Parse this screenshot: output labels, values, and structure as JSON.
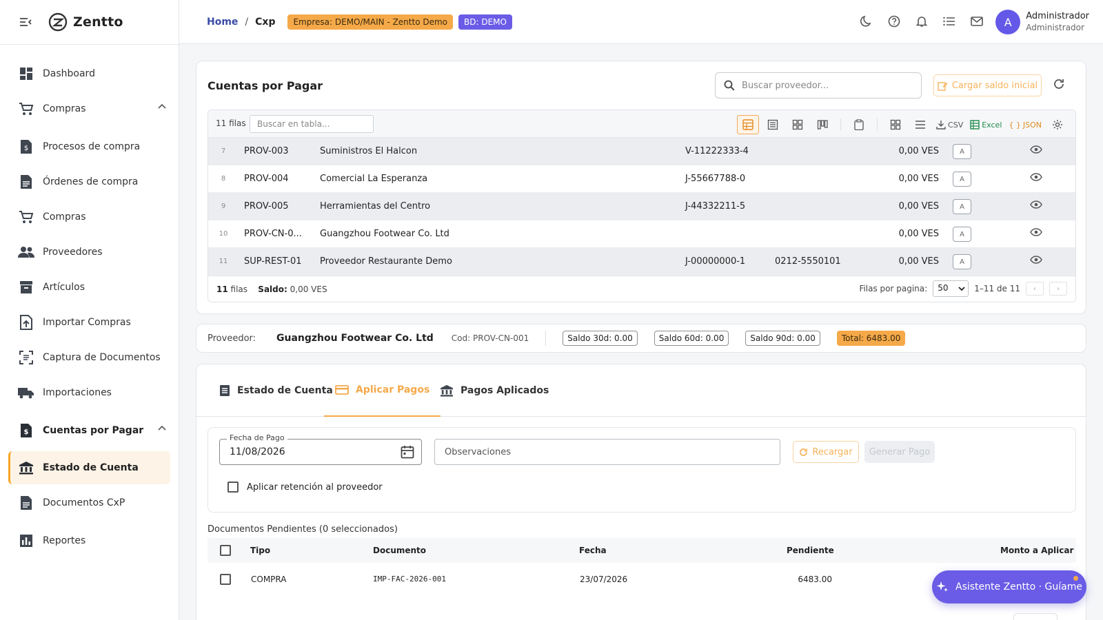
{
  "app": {
    "logo_text": "Zentto"
  },
  "sidebar": {
    "items": [
      {
        "label": "Dashboard",
        "icon": "dashboard-icon"
      },
      {
        "label": "Compras",
        "icon": "cart-icon",
        "expanded": true
      },
      {
        "label": "Procesos de compra",
        "icon": "dollar-doc-icon"
      },
      {
        "label": "Órdenes de compra",
        "icon": "document-icon"
      },
      {
        "label": "Compras",
        "icon": "cart-icon"
      },
      {
        "label": "Proveedores",
        "icon": "people-icon"
      },
      {
        "label": "Artículos",
        "icon": "archive-icon"
      },
      {
        "label": "Importar Compras",
        "icon": "upload-doc-icon"
      },
      {
        "label": "Captura de Documentos",
        "icon": "scan-icon"
      },
      {
        "label": "Importaciones",
        "icon": "truck-icon"
      },
      {
        "label": "Cuentas por Pagar",
        "icon": "dollar-doc-icon",
        "expanded": true
      },
      {
        "label": "Estado de Cuenta",
        "icon": "bank-icon",
        "active": true
      },
      {
        "label": "Documentos CxP",
        "icon": "document-icon"
      },
      {
        "label": "Reportes",
        "icon": "bar-chart-icon"
      }
    ]
  },
  "header": {
    "breadcrumb_home": "Home",
    "breadcrumb_sep": "/",
    "breadcrumb_current": "Cxp",
    "empresa_chip": "Empresa: DEMO/MAIN - Zentto Demo",
    "bd_chip": "BD: DEMO",
    "user_initial": "A",
    "user_name": "Administrador",
    "user_role": "Administrador"
  },
  "cxp": {
    "title": "Cuentas por Pagar",
    "search_placeholder": "Buscar proveedor...",
    "load_balance_label": "Cargar saldo inicial",
    "grid": {
      "row_count_label": "11 filas",
      "search_placeholder": "Buscar en tabla...",
      "csv_label": "CSV",
      "excel_label": "Excel",
      "json_label": "JSON",
      "rows": [
        {
          "num": "7",
          "code": "PROV-003",
          "name": "Suministros El Halcon",
          "rif": "V-11222333-4",
          "tel": "",
          "saldo": "0,00 VES",
          "badge": "A"
        },
        {
          "num": "8",
          "code": "PROV-004",
          "name": "Comercial La Esperanza",
          "rif": "J-55667788-0",
          "tel": "",
          "saldo": "0,00 VES",
          "badge": "A"
        },
        {
          "num": "9",
          "code": "PROV-005",
          "name": "Herramientas del Centro",
          "rif": "J-44332211-5",
          "tel": "",
          "saldo": "0,00 VES",
          "badge": "A"
        },
        {
          "num": "10",
          "code": "PROV-CN-0...",
          "name": "Guangzhou Footwear Co. Ltd",
          "rif": "",
          "tel": "",
          "saldo": "0,00 VES",
          "badge": "A"
        },
        {
          "num": "11",
          "code": "SUP-REST-01",
          "name": "Proveedor Restaurante Demo",
          "rif": "J-00000000-1",
          "tel": "0212-5550101",
          "saldo": "0,00 VES",
          "badge": "A"
        }
      ],
      "footer_count": "11",
      "footer_rows_word": "filas",
      "footer_saldo_label": "Saldo:",
      "footer_saldo_value": "0,00 VES",
      "rows_per_page_label": "Filas por pagina:",
      "rows_per_page_value": "50",
      "range_label": "1–11 de 11",
      "prev": "‹",
      "next": "›"
    }
  },
  "proveedor": {
    "label": "Proveedor:",
    "name": "Guangzhou Footwear Co. Ltd",
    "cod": "Cod: PROV-CN-001",
    "saldo30": "Saldo 30d: 0.00",
    "saldo60": "Saldo 60d: 0.00",
    "saldo90": "Saldo 90d: 0.00",
    "total": "Total: 6483.00"
  },
  "tabs": [
    {
      "label": "Estado de Cuenta",
      "icon": "list-doc-icon"
    },
    {
      "label": "Aplicar Pagos",
      "icon": "credit-card-icon",
      "active": true
    },
    {
      "label": "Pagos Aplicados",
      "icon": "bank-icon"
    }
  ],
  "payment": {
    "date_label": "Fecha de Pago",
    "date_value": "11/08/2026",
    "obs_placeholder": "Observaciones",
    "reload_label": "Recargar",
    "generate_label": "Generar Pago",
    "retention_label": "Aplicar retención al proveedor"
  },
  "pending": {
    "title": "Documentos Pendientes (0 seleccionados)",
    "headers": {
      "tipo": "Tipo",
      "documento": "Documento",
      "fecha": "Fecha",
      "pendiente": "Pendiente",
      "monto": "Monto a Aplicar"
    },
    "rows": [
      {
        "tipo": "COMPRA",
        "documento": "IMP-FAC-2026-001",
        "fecha": "23/07/2026",
        "pendiente": "6483.00"
      }
    ]
  },
  "assistant": {
    "label": "Asistente Zentto · Guíame"
  },
  "colors": {
    "accent": "#f5a948",
    "brand": "#6a5ce6",
    "link": "#3a4aa8"
  }
}
